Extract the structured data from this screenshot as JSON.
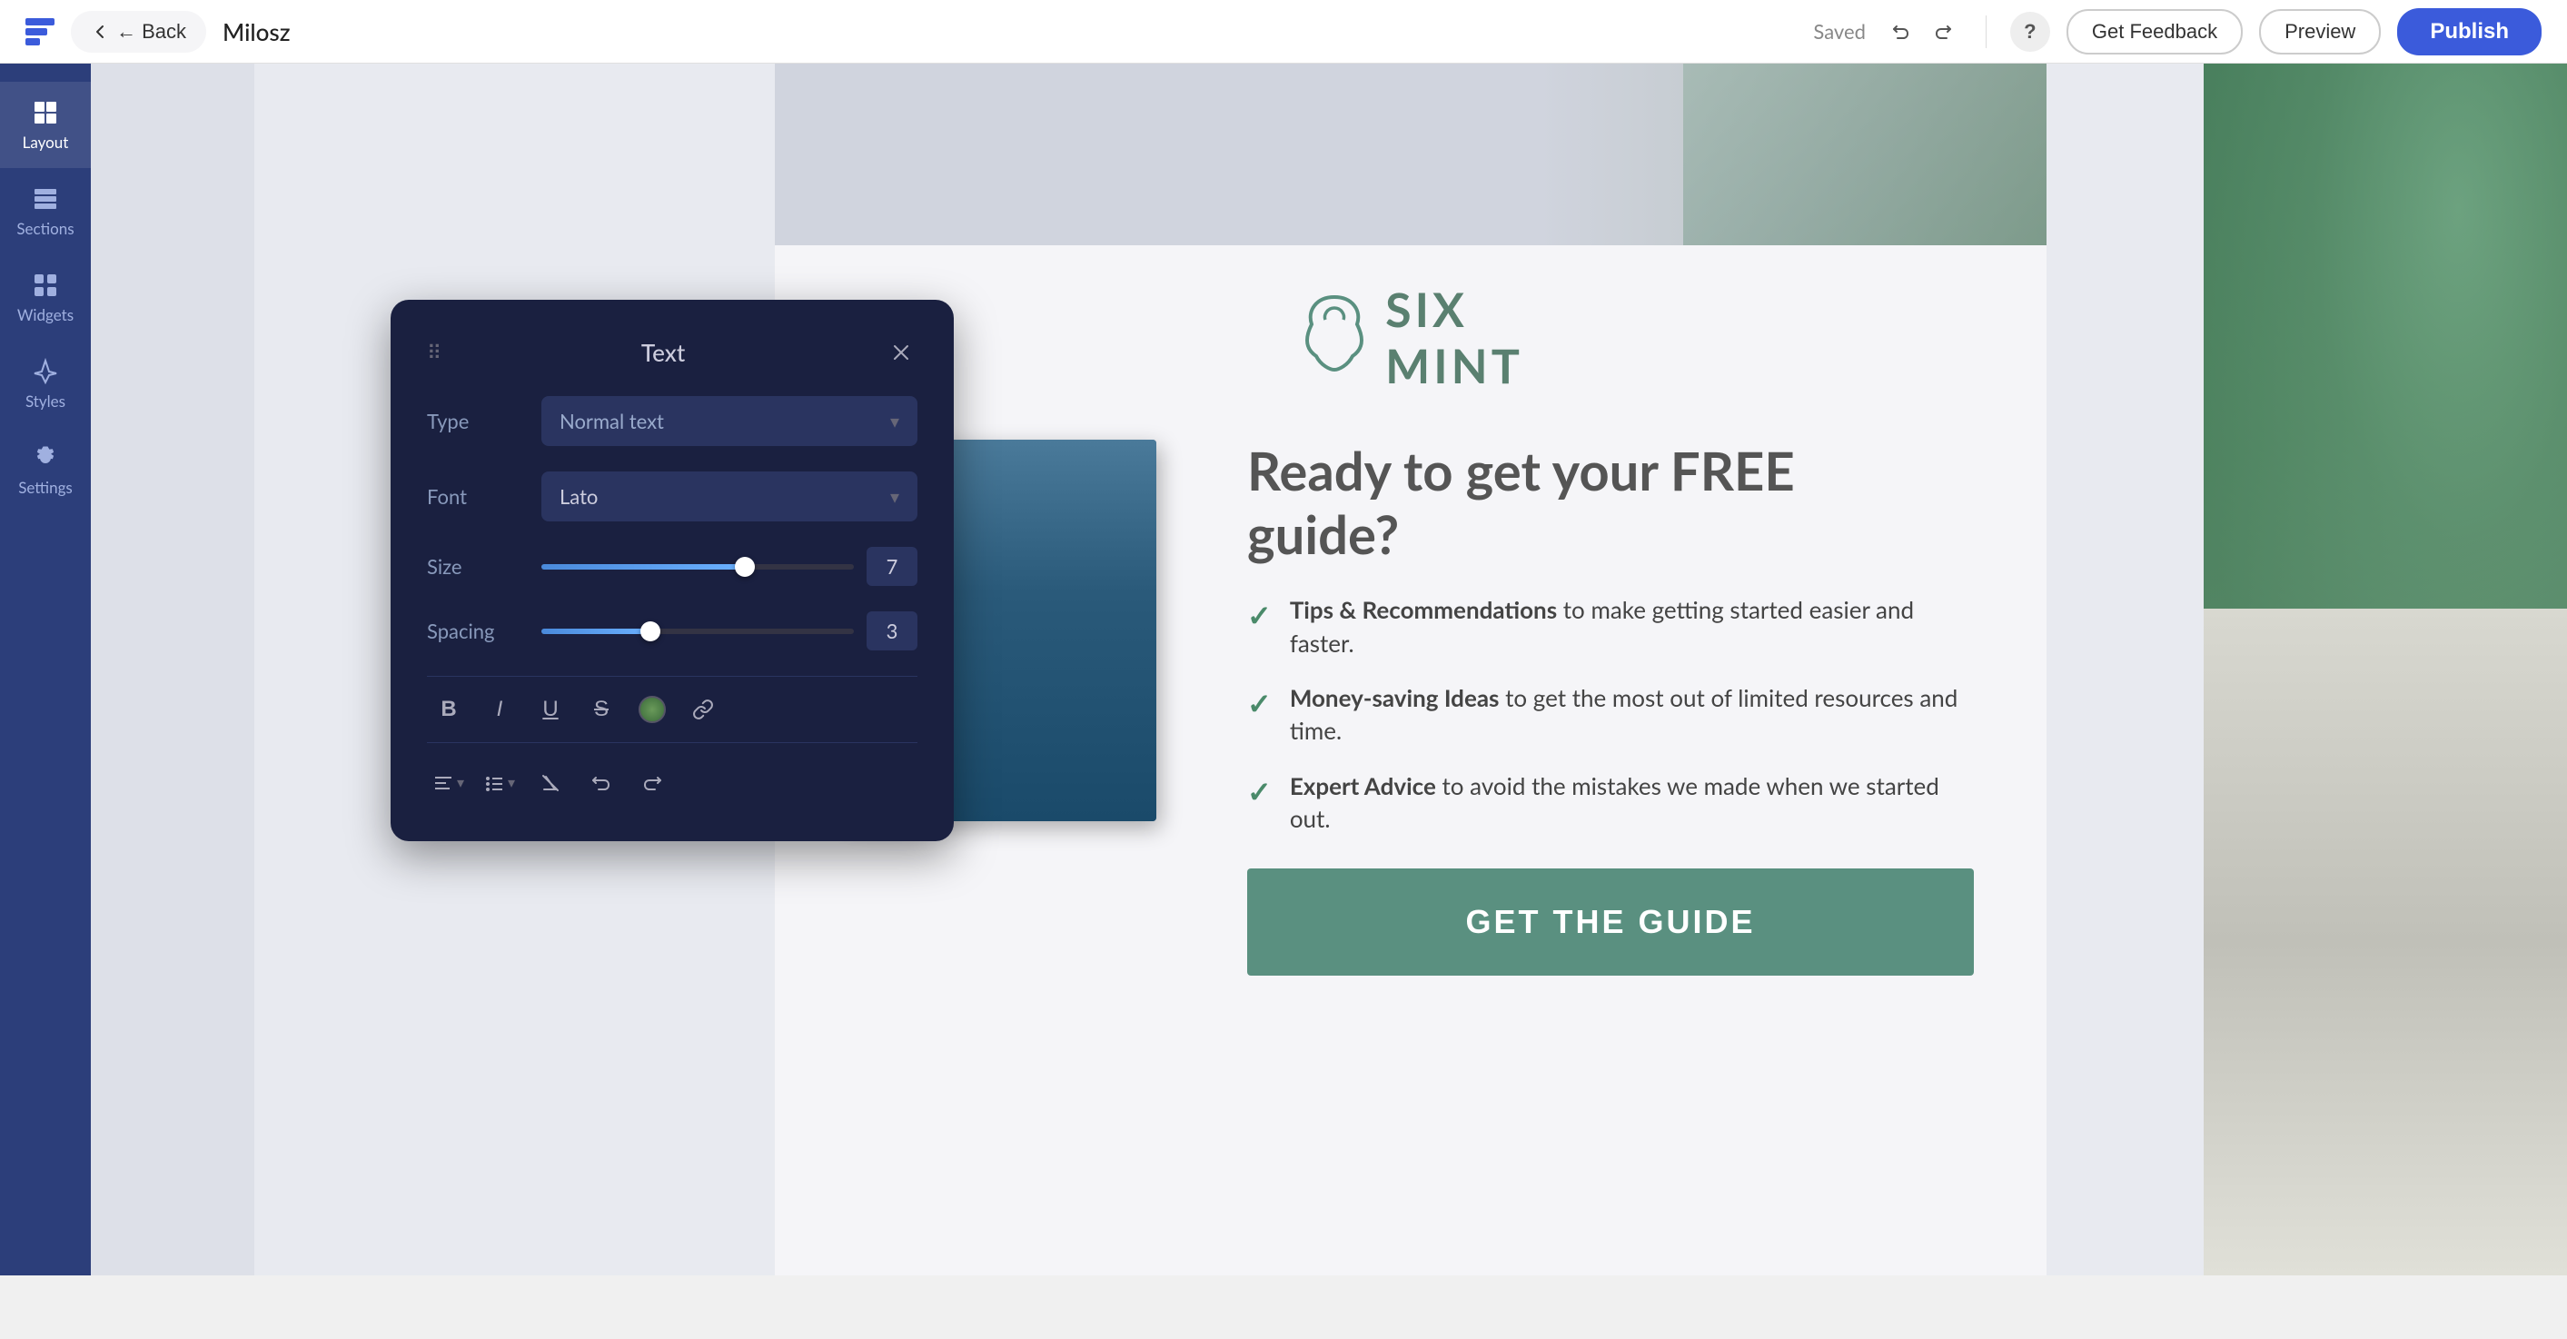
{
  "topbar": {
    "back_label": "← Back",
    "page_name": "Milosz",
    "saved_label": "Saved",
    "help_label": "?",
    "feedback_label": "Get Feedback",
    "preview_label": "Preview",
    "publish_label": "Publish"
  },
  "sidebar": {
    "items": [
      {
        "id": "layout",
        "label": "Layout",
        "icon": "layout-icon"
      },
      {
        "id": "sections",
        "label": "Sections",
        "icon": "sections-icon"
      },
      {
        "id": "widgets",
        "label": "Widgets",
        "icon": "widgets-icon"
      },
      {
        "id": "styles",
        "label": "Styles",
        "icon": "styles-icon"
      },
      {
        "id": "settings",
        "label": "Settings",
        "icon": "settings-icon"
      }
    ]
  },
  "text_panel": {
    "title": "Text",
    "type_label": "Type",
    "type_value": "Normal text",
    "font_label": "Font",
    "font_value": "Lato",
    "size_label": "Size",
    "size_value": "7",
    "spacing_label": "Spacing",
    "spacing_value": "3"
  },
  "page_content": {
    "brand_name_line1": "SIX",
    "brand_name_line2": "MINT",
    "hero_title_line1": "Ready to get your FREE",
    "hero_title_line2": "guide?",
    "feature_1_bold": "Tips & Recommendations",
    "feature_1_text": " to make getting started easier and faster.",
    "feature_2_bold": "Money-saving Ideas",
    "feature_2_text": " to get the most out of limited resources and time.",
    "feature_3_bold": "Expert Advice",
    "feature_3_text": " to avoid the mistakes we made when we started out.",
    "cta_label": "GET THE GUIDE"
  }
}
